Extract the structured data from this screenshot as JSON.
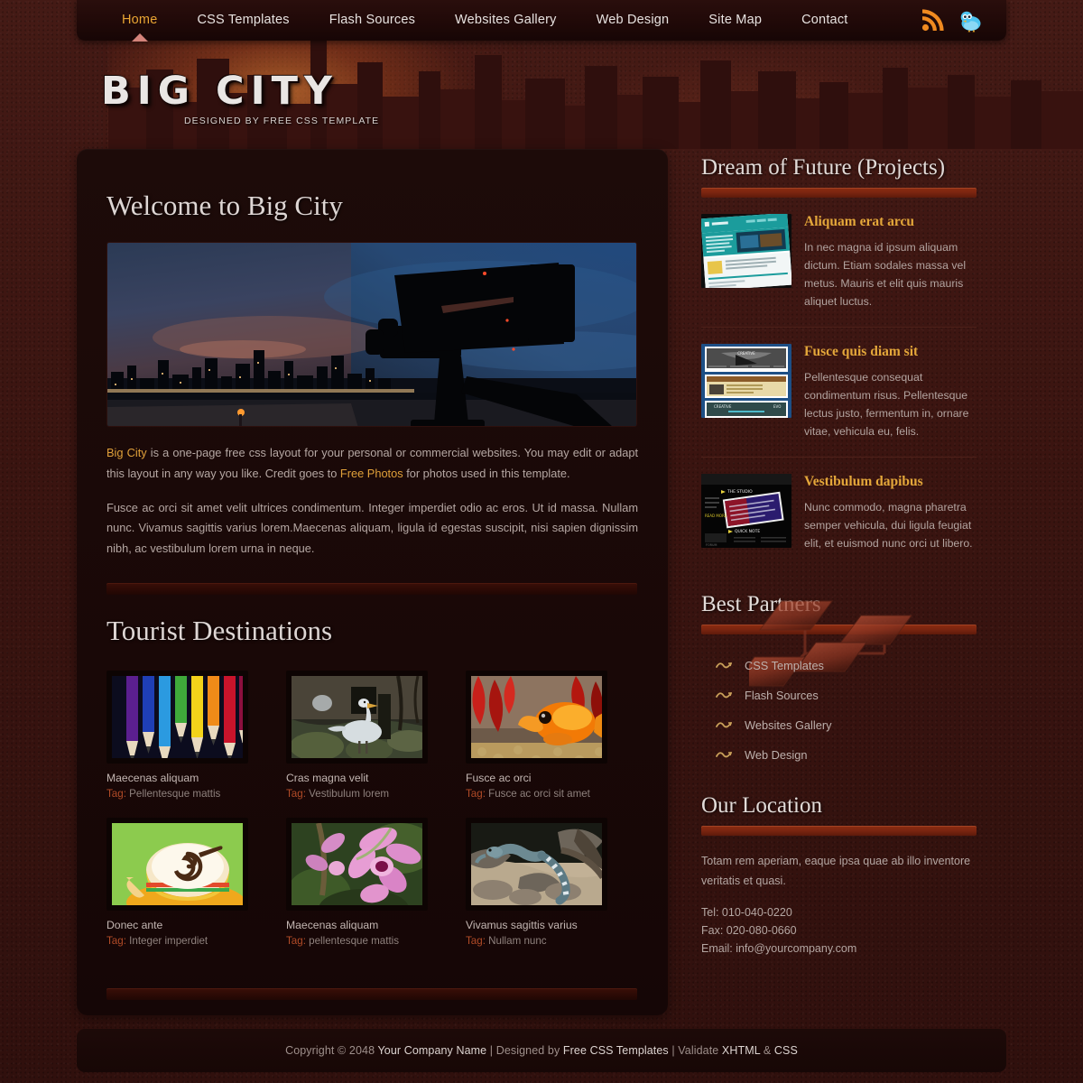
{
  "nav": {
    "items": [
      {
        "label": "Home",
        "active": true
      },
      {
        "label": "CSS Templates",
        "active": false
      },
      {
        "label": "Flash Sources",
        "active": false
      },
      {
        "label": "Websites Gallery",
        "active": false
      },
      {
        "label": "Web Design",
        "active": false
      },
      {
        "label": "Site Map",
        "active": false
      },
      {
        "label": "Contact",
        "active": false
      }
    ],
    "social": [
      {
        "name": "rss-icon",
        "color": "#f08a20"
      },
      {
        "name": "twitter-bird-icon",
        "color": "#4cc3ef"
      }
    ]
  },
  "logo": {
    "title": "BIG CITY",
    "tagline": "DESIGNED BY FREE CSS TEMPLATE"
  },
  "main": {
    "welcome_heading": "Welcome to Big City",
    "hero_image_alt": "Night city skyline with video camera silhouette",
    "paragraph1": {
      "link1": "Big City",
      "mid1": " is a one-page free css layout for your personal or commercial websites. You may edit or adapt this layout in any way you like. Credit goes to ",
      "link2": "Free Photos",
      "mid2": " for photos used in this template."
    },
    "paragraph2": "Fusce ac orci sit amet velit ultrices condimentum. Integer imperdiet odio ac eros. Ut id massa. Nullam nunc. Vivamus sagittis varius lorem.Maecenas aliquam, ligula id egestas suscipit, nisi sapien dignissim nibh, ac vestibulum lorem urna in neque.",
    "gallery_heading": "Tourist Destinations",
    "tag_label": "Tag:",
    "gallery": [
      {
        "caption": "Maecenas aliquam",
        "tag": "Pellentesque mattis",
        "image": "colored-pencils"
      },
      {
        "caption": "Cras magna velit",
        "tag": "Vestibulum lorem",
        "image": "heron-rocks"
      },
      {
        "caption": "Fusce ac orci",
        "tag": "Fusce ac orci sit amet",
        "image": "goldfish"
      },
      {
        "caption": "Donec ante",
        "tag": "Integer imperdiet",
        "image": "coffee-cup"
      },
      {
        "caption": "Maecenas aliquam",
        "tag": "pellentesque mattis",
        "image": "pink-orchid"
      },
      {
        "caption": "Vivamus sagittis varius",
        "tag": "Nullam nunc",
        "image": "iguana-rocks"
      }
    ]
  },
  "sidebar": {
    "projects": {
      "heading": "Dream of Future (Projects)",
      "items": [
        {
          "title": "Aliquam erat arcu",
          "text": "In nec magna id ipsum aliquam dictum. Etiam sodales massa vel metus. Mauris et elit quis mauris aliquet luctus.",
          "thumb": "teal-website-screenshot"
        },
        {
          "title": "Fusce quis diam sit",
          "text": "Pellentesque consequat condimentum risus. Pellentesque lectus justo, fermentum in, ornare vitae, vehicula eu, felis.",
          "thumb": "blue-layout-stack-screenshot"
        },
        {
          "title": "Vestibulum dapibus",
          "text": "Nunc commodo, magna pharetra semper vehicula, dui ligula feugiat elit, et euismod nunc orci ut libero.",
          "thumb": "dark-studio-website-screenshot"
        }
      ]
    },
    "partners": {
      "heading": "Best Partners",
      "items": [
        "CSS Templates",
        "Flash Sources",
        "Websites Gallery",
        "Web Design"
      ]
    },
    "location": {
      "heading": "Our Location",
      "text": "Totam rem aperiam, eaque ipsa quae ab illo inventore veritatis et quasi.",
      "tel": "Tel: 010-040-0220",
      "fax": "Fax: 020-080-0660",
      "email": "Email: info@yourcompany.com"
    }
  },
  "footer": {
    "copyright_prefix": "Copyright © 2048 ",
    "company": "Your Company Name",
    "sep1": " | Designed by ",
    "designer": "Free CSS Templates",
    "sep2": " | Validate ",
    "validate_xhtml": "XHTML",
    "amp": " & ",
    "validate_css": "CSS"
  },
  "colors": {
    "accent_gold": "#e9a533",
    "accent_red": "#8d2c11",
    "page_bg": "#3c1612",
    "panel_bg": "#1d0b09"
  }
}
